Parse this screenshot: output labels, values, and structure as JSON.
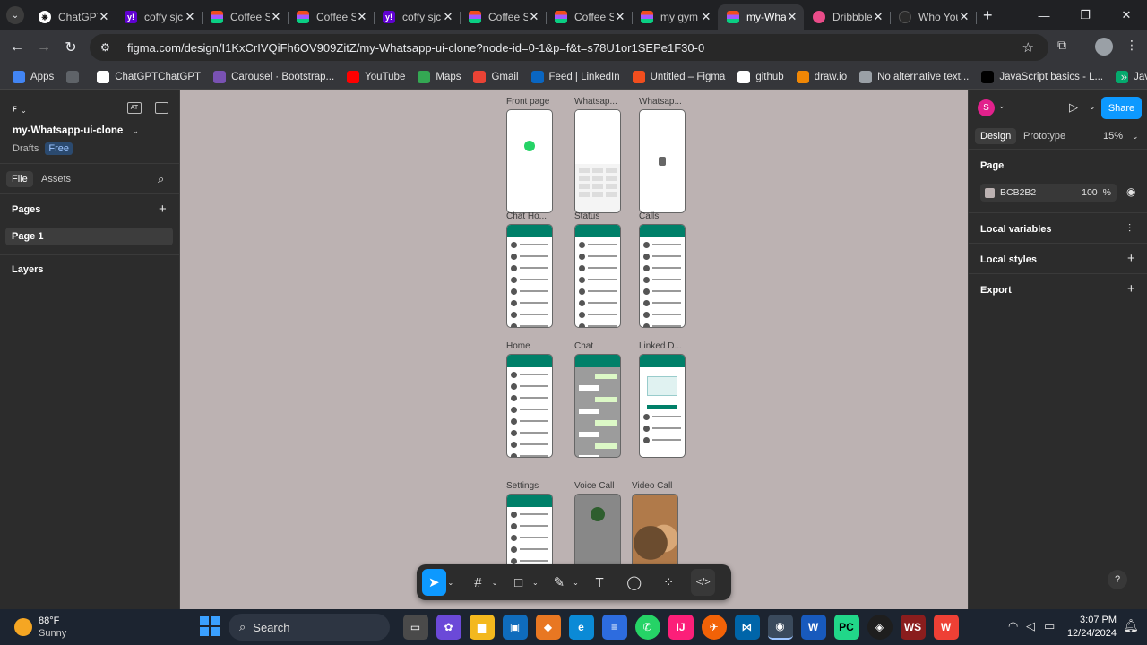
{
  "browser": {
    "tabs": [
      {
        "title": "ChatGPT",
        "icon": "chatgpt-icon",
        "active": false
      },
      {
        "title": "coffy sjc",
        "icon": "yahoo-icon",
        "active": false
      },
      {
        "title": "Coffee S",
        "icon": "figma-icon",
        "active": false
      },
      {
        "title": "Coffee S",
        "icon": "figma-icon",
        "active": false
      },
      {
        "title": "coffy sjc",
        "icon": "yahoo-icon",
        "active": false
      },
      {
        "title": "Coffee S",
        "icon": "figma-icon",
        "active": false
      },
      {
        "title": "Coffee S",
        "icon": "figma-icon",
        "active": false
      },
      {
        "title": "my gym",
        "icon": "figma-icon",
        "active": false
      },
      {
        "title": "my-Wha",
        "icon": "figma-icon",
        "active": true
      },
      {
        "title": "Dribbble",
        "icon": "dribbble-icon",
        "active": false
      },
      {
        "title": "Who You",
        "icon": "globe-icon",
        "active": false
      }
    ],
    "url": "figma.com/design/I1KxCrIVQiFh6OV909ZitZ/my-Whatsapp-ui-clone?node-id=0-1&p=f&t=s78U1or1SEPe1F30-0",
    "bookmarks": [
      {
        "label": "Apps",
        "color": "#4285f4"
      },
      {
        "label": "",
        "color": "#5f6368"
      },
      {
        "label": "ChatGPTChatGPT",
        "color": "#ffffff"
      },
      {
        "label": "Carousel · Bootstrap...",
        "color": "#7952b3"
      },
      {
        "label": "YouTube",
        "color": "#ff0000"
      },
      {
        "label": "Maps",
        "color": "#34a853"
      },
      {
        "label": "Gmail",
        "color": "#ea4335"
      },
      {
        "label": "Feed | LinkedIn",
        "color": "#0a66c2"
      },
      {
        "label": "Untitled – Figma",
        "color": "#f24e1e"
      },
      {
        "label": "github",
        "color": "#ffffff"
      },
      {
        "label": "draw.io",
        "color": "#f08705"
      },
      {
        "label": "No alternative text...",
        "color": "#9aa0a6"
      },
      {
        "label": "JavaScript basics - L...",
        "color": "#000000"
      },
      {
        "label": "Java Tutorial",
        "color": "#04aa6d"
      }
    ]
  },
  "figma": {
    "file_name": "my-Whatsapp-ui-clone",
    "drafts_label": "Drafts",
    "plan_badge": "Free",
    "tab_file": "File",
    "tab_assets": "Assets",
    "pages_heading": "Pages",
    "page_1": "Page 1",
    "layers_heading": "Layers",
    "design_tab": "Design",
    "prototype_tab": "Prototype",
    "zoom": "15%",
    "share_label": "Share",
    "avatar_letter": "S",
    "page_section": "Page",
    "page_color": "BCB2B2",
    "page_opacity": "100",
    "percent": "%",
    "local_variables": "Local variables",
    "local_styles": "Local styles",
    "export": "Export",
    "help": "?"
  },
  "canvas": {
    "background": "#BCB2B2",
    "frames": [
      {
        "label": "Front page"
      },
      {
        "label": "Whatsap..."
      },
      {
        "label": "Whatsap..."
      },
      {
        "label": "Chat Ho..."
      },
      {
        "label": "Status"
      },
      {
        "label": "Calls"
      },
      {
        "label": "Home"
      },
      {
        "label": "Chat"
      },
      {
        "label": "Linked D..."
      },
      {
        "label": "Settings"
      },
      {
        "label": "Voice Call"
      },
      {
        "label": "Video Call"
      }
    ]
  },
  "taskbar": {
    "temperature": "88°F",
    "weather": "Sunny",
    "search_label": "Search",
    "time": "3:07 PM",
    "date": "12/24/2024"
  }
}
